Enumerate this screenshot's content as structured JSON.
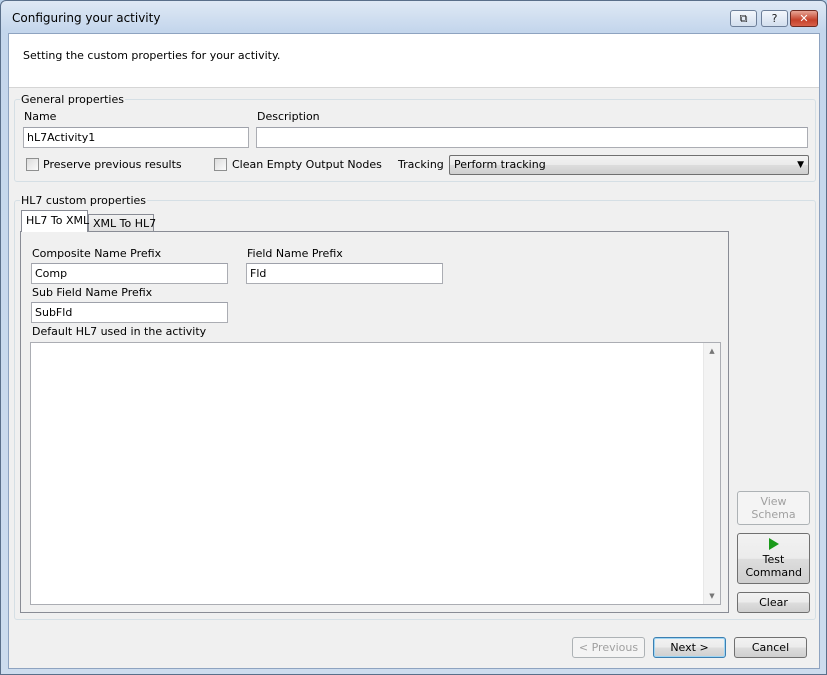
{
  "window": {
    "title": "Configuring your activity",
    "controls": {
      "restore": "⧉",
      "help": "?",
      "close": "✕"
    }
  },
  "header": {
    "text": "Setting the custom properties for your activity."
  },
  "general": {
    "label": "General properties",
    "name_label": "Name",
    "name_value": "hL7Activity1",
    "description_label": "Description",
    "description_value": "",
    "preserve_label": "Preserve previous results",
    "clean_label": "Clean Empty Output Nodes",
    "tracking_label": "Tracking",
    "tracking_value": "Perform tracking"
  },
  "hl7": {
    "label": "HL7 custom properties",
    "tabs": [
      "HL7 To XML",
      "XML To HL7"
    ],
    "composite_label": "Composite Name Prefix",
    "composite_value": "Comp",
    "field_label": "Field Name Prefix",
    "field_value": "Fld",
    "subfield_label": "Sub Field Name Prefix",
    "subfield_value": "SubFld",
    "default_label": "Default HL7 used in the activity",
    "default_value": ""
  },
  "side_buttons": {
    "view_schema": "View Schema",
    "test_command": "Test Command",
    "clear": "Clear"
  },
  "footer": {
    "previous": "< Previous",
    "next": "Next >",
    "cancel": "Cancel"
  },
  "colors": {
    "accent": "#3c7fb1",
    "play": "#1a9a1a"
  }
}
